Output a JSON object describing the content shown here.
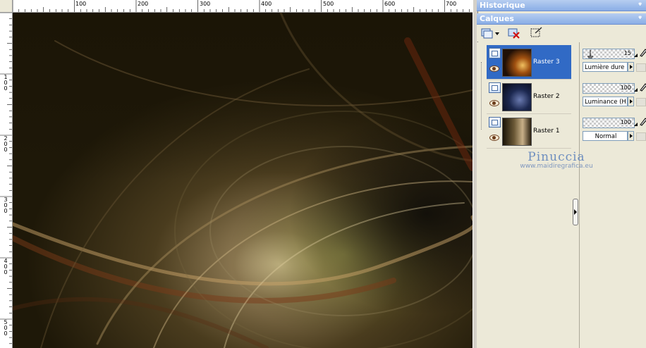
{
  "rulers": {
    "top_labels": [
      "100",
      "200",
      "300",
      "400",
      "500",
      "600",
      "700"
    ],
    "left_labels": [
      "1 0 0",
      "2 0 0",
      "3 0 0",
      "4 0 0",
      "5 0 0"
    ]
  },
  "panels": {
    "historique": {
      "title": "Historique",
      "pin": "ᵠ"
    },
    "calques": {
      "title": "Calques",
      "pin": "ᵠ"
    }
  },
  "layers": [
    {
      "name": "Raster 3",
      "opacity": "15",
      "blend_mode": "Lumière dure",
      "selected": true
    },
    {
      "name": "Raster 2",
      "opacity": "100",
      "blend_mode": "Luminance (H)",
      "selected": false
    },
    {
      "name": "Raster 1",
      "opacity": "100",
      "blend_mode": "Normal",
      "selected": false
    }
  ],
  "watermark": {
    "name": "Pinuccia",
    "url": "www.maidiregrafica.eu"
  },
  "colors": {
    "selection": "#316ac5",
    "panel_title": "#8aaee6",
    "canvas_base": "#2a2208"
  }
}
